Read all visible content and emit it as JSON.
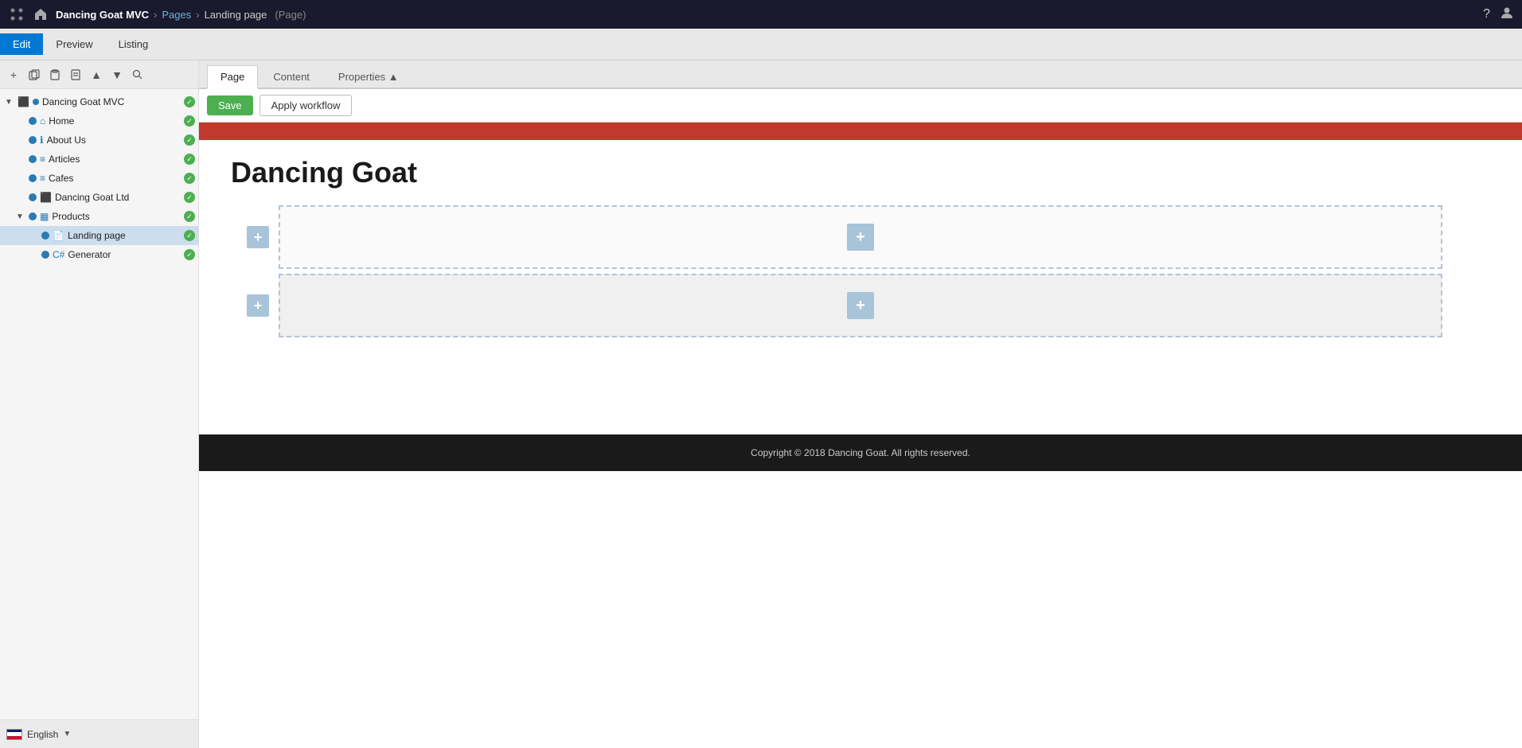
{
  "topbar": {
    "logo_icon": "⚙",
    "app_icon": "🏠",
    "site_name": "Dancing Goat MVC",
    "breadcrumb_arrow": "›",
    "pages_link": "Pages",
    "separator": "›",
    "current_page": "Landing page",
    "page_type": "(Page)",
    "help_icon": "?",
    "user_icon": "👤"
  },
  "editbar": {
    "edit_label": "Edit",
    "preview_label": "Preview",
    "listing_label": "Listing"
  },
  "sidebar": {
    "toolbar": {
      "add": "+",
      "copy": "⧉",
      "paste": "📋",
      "page": "📄",
      "up": "▲",
      "down": "▼",
      "search": "🔍"
    },
    "tree": [
      {
        "id": "dancing-goat-mvc",
        "label": "Dancing Goat MVC",
        "indent": 0,
        "expanded": true,
        "icon": "grid",
        "has_status": true
      },
      {
        "id": "home",
        "label": "Home",
        "indent": 1,
        "expanded": false,
        "icon": "home",
        "has_status": true
      },
      {
        "id": "about-us",
        "label": "About Us",
        "indent": 1,
        "expanded": false,
        "icon": "info",
        "has_status": true
      },
      {
        "id": "articles",
        "label": "Articles",
        "indent": 1,
        "expanded": false,
        "icon": "list",
        "has_status": true
      },
      {
        "id": "cafes",
        "label": "Cafes",
        "indent": 1,
        "expanded": false,
        "icon": "list",
        "has_status": true
      },
      {
        "id": "dancing-goat-ltd",
        "label": "Dancing Goat Ltd",
        "indent": 1,
        "expanded": false,
        "icon": "grid",
        "has_status": true
      },
      {
        "id": "products",
        "label": "Products",
        "indent": 1,
        "expanded": true,
        "icon": "grid2",
        "has_status": true
      },
      {
        "id": "landing-page",
        "label": "Landing page",
        "indent": 2,
        "expanded": false,
        "icon": "doc",
        "has_status": true,
        "selected": true
      },
      {
        "id": "generator",
        "label": "Generator",
        "indent": 2,
        "expanded": false,
        "icon": "csharp",
        "has_status": true
      }
    ],
    "footer": {
      "language": "English",
      "dropdown_arrow": "▼"
    }
  },
  "tabs": [
    {
      "id": "page",
      "label": "Page",
      "active": true
    },
    {
      "id": "content",
      "label": "Content",
      "active": false
    },
    {
      "id": "properties",
      "label": "Properties ▲",
      "active": false
    }
  ],
  "actionbar": {
    "save_label": "Save",
    "workflow_label": "Apply workflow"
  },
  "preview": {
    "title": "Dancing Goat",
    "footer_text": "Copyright © 2018 Dancing Goat. All rights reserved.",
    "add_section_label": "+",
    "add_widget_label": "+"
  }
}
